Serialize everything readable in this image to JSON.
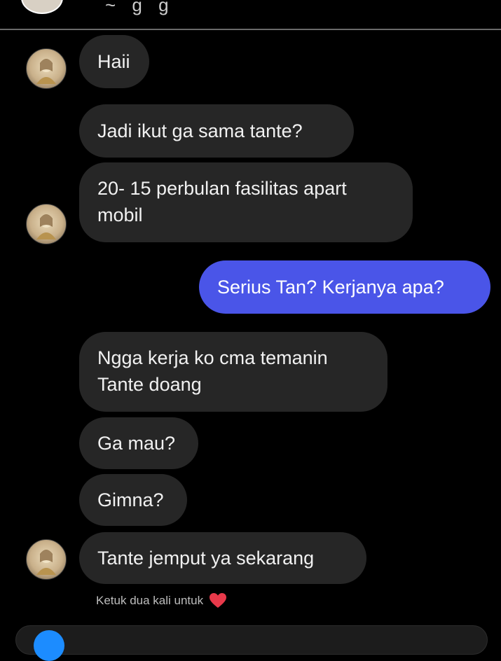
{
  "header": {
    "contact_name": "~ g g",
    "avatar_icon": "contact-avatar"
  },
  "messages": [
    {
      "id": "m1",
      "direction": "incoming",
      "text": "Haii"
    },
    {
      "id": "m2",
      "direction": "incoming",
      "text": "Jadi ikut ga sama tante?"
    },
    {
      "id": "m3",
      "direction": "incoming",
      "text": "20- 15 perbulan fasilitas apart mobil"
    },
    {
      "id": "m4",
      "direction": "outgoing",
      "text": "Serius Tan? Kerjanya apa?"
    },
    {
      "id": "m5",
      "direction": "incoming",
      "text": "Ngga kerja ko cma temanin Tante doang"
    },
    {
      "id": "m6",
      "direction": "incoming",
      "text": "Ga mau?"
    },
    {
      "id": "m7",
      "direction": "incoming",
      "text": "Gimna?"
    },
    {
      "id": "m8",
      "direction": "incoming",
      "text": "Tante jemput ya sekarang"
    }
  ],
  "hint": {
    "text": "Ketuk dua kali untuk",
    "icon": "heart-icon",
    "color": "#e8394a"
  },
  "colors": {
    "background": "#000000",
    "incoming_bubble": "#262626",
    "outgoing_bubble": "#4a55e8",
    "accent": "#1c8cff"
  }
}
